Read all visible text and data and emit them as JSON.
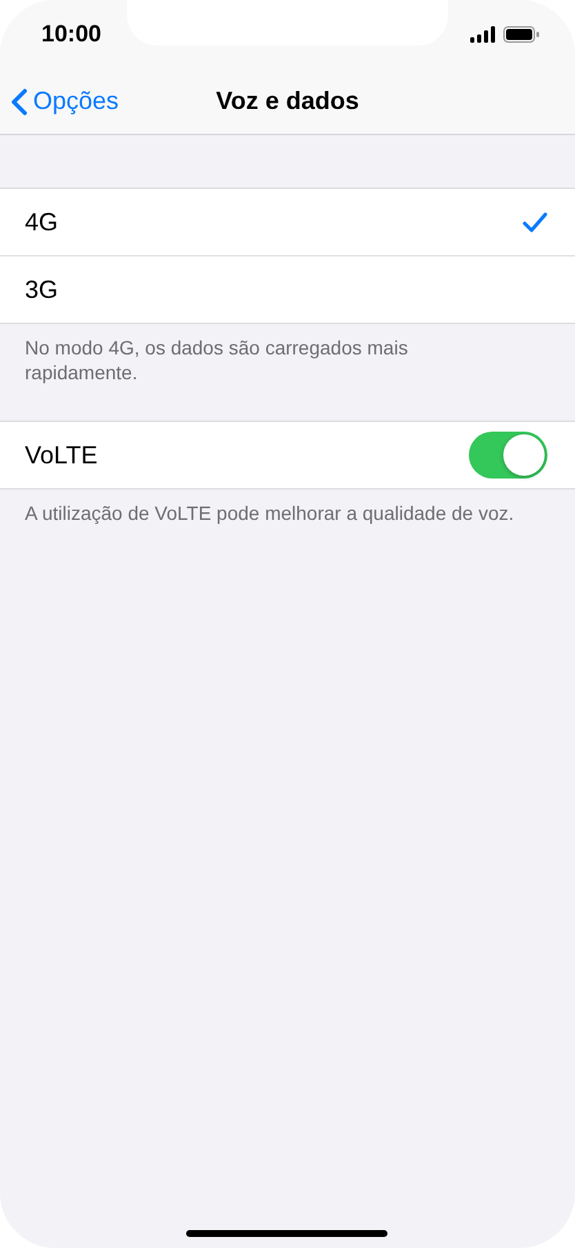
{
  "status_bar": {
    "time": "10:00"
  },
  "nav": {
    "back": "Opções",
    "title": "Voz e dados"
  },
  "network_options": [
    {
      "label": "4G",
      "selected": true
    },
    {
      "label": "3G",
      "selected": false
    }
  ],
  "network_footer": "No modo 4G, os dados são carregados mais rapidamente.",
  "volte": {
    "label": "VoLTE",
    "on": true
  },
  "volte_footer": "A utilização de VoLTE pode melhorar a qualidade de voz."
}
